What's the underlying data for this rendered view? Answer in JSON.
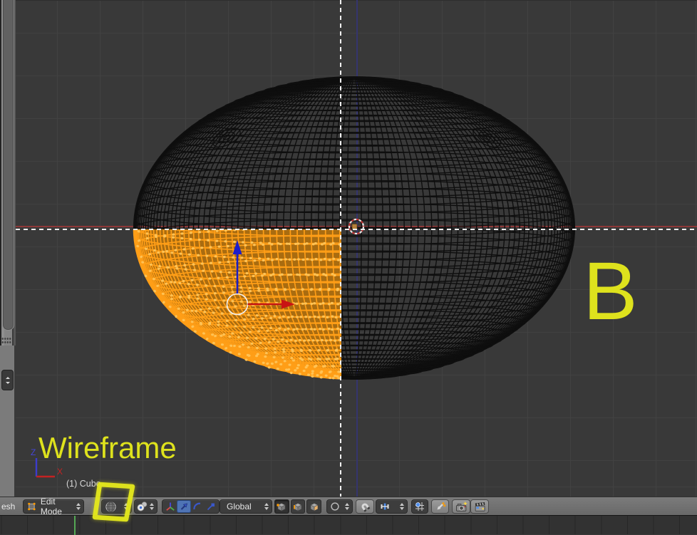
{
  "annotations": {
    "b_key": "B",
    "wireframe": "Wireframe"
  },
  "viewport": {
    "object_info": "(1) Cube",
    "axis_gizmo": {
      "z_label": "Z",
      "x_label": "X"
    }
  },
  "header": {
    "mesh_menu_fragment": "esh",
    "mode": "Edit Mode",
    "orientation": "Global",
    "icons": {
      "mode_icon": "edit-mode-cube",
      "shading_icon": "viewport-shading-globe",
      "pivot_icon": "pivot-median-point",
      "manipulators": [
        "axis-tripod",
        "translate-arrow",
        "rotate-arc",
        "scale-square"
      ],
      "select_modes": [
        "vertex-select-cube",
        "edge-select-cube",
        "face-select-cube"
      ],
      "proportional_icon": "proportional-edit-circle",
      "snap_magnet_icon": "snap-magnet",
      "snap_element_icon": "snap-vertex",
      "snap_target_icon": "snap-target",
      "centers_icon": "manipulate-centers",
      "render_icon": "opengl-render-camera",
      "render_anim_icon": "opengl-render-clapper"
    }
  },
  "colors": {
    "annotation_yellow": "#dee21d",
    "selection_fill": "#a96c10",
    "selection_wire": "#ff9e17",
    "grid_axis_red": "#8d3838",
    "grid_axis_blue": "#35356e",
    "active_tool_blue": "#4f74b5",
    "playhead_green": "#55a755",
    "mesh_wire": "#0e0e0e"
  }
}
